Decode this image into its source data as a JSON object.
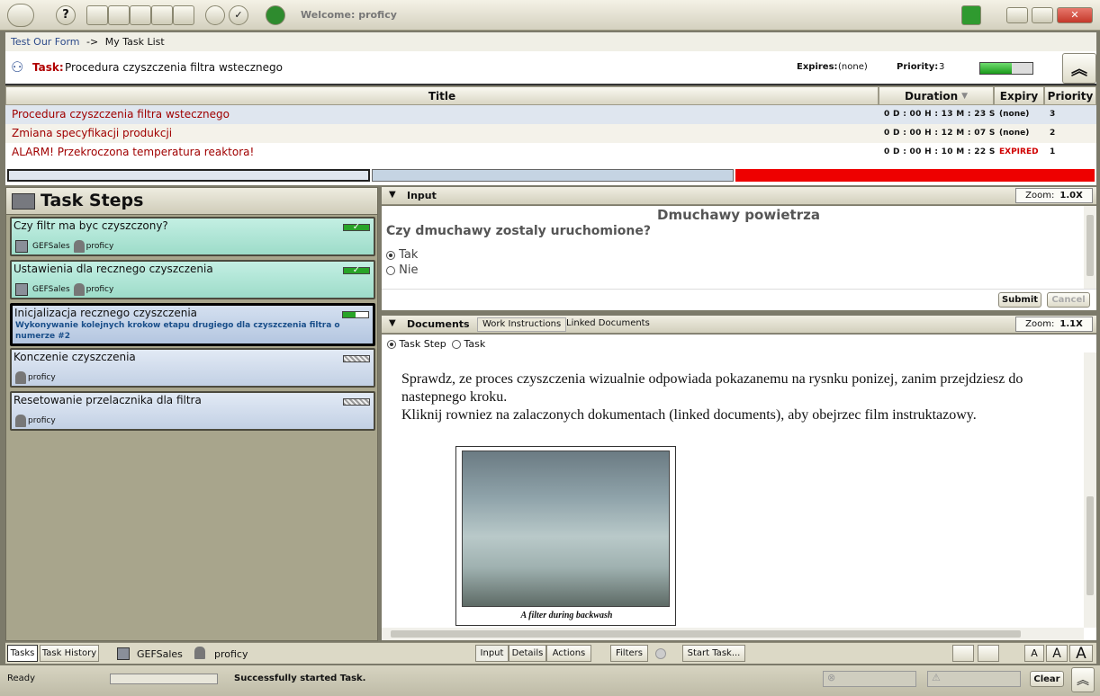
{
  "app": {
    "welcome": "Welcome: proficy"
  },
  "breadcrumb": {
    "form": "Test Our Form",
    "separator": "->",
    "current": "My Task List"
  },
  "task_header": {
    "label": "Task:",
    "name": "Procedura czyszczenia filtra wstecznego",
    "expires_label": "Expires:",
    "expires_value": "(none)",
    "priority_label": "Priority:",
    "priority_value": "3",
    "progress": 0.6
  },
  "task_table": {
    "columns": [
      "Title",
      "Duration",
      "Expiry",
      "Priority"
    ],
    "rows": [
      {
        "title": "Procedura czyszczenia filtra wstecznego",
        "duration": "0 D : 00 H : 13 M : 23 S",
        "expiry": "(none)",
        "priority": "3"
      },
      {
        "title": "Zmiana specyfikacji produkcji",
        "duration": "0 D : 00 H : 12 M : 07 S",
        "expiry": "(none)",
        "priority": "2"
      },
      {
        "title": "ALARM! Przekroczona temperatura reaktora!",
        "duration": "0 D : 00 H : 10 M : 22 S",
        "expiry": "EXPIRED",
        "priority": "1"
      }
    ]
  },
  "steps_panel": {
    "title": "Task Steps",
    "steps": [
      {
        "name": "Czy filtr ma byc czyszczony?",
        "group": "GEFSales",
        "user": "proficy",
        "status": "complete"
      },
      {
        "name": "Ustawienia dla recznego czyszczenia",
        "group": "GEFSales",
        "user": "proficy",
        "status": "complete"
      },
      {
        "name": "Inicjalizacja recznego czyszczenia",
        "description": "Wykonywanie kolejnych krokow etapu drugiego dla czyszczenia filtra o numerze #2",
        "status": "active"
      },
      {
        "name": "Konczenie czyszczenia",
        "user": "proficy",
        "status": "pending"
      },
      {
        "name": "Resetowanie przelacznika dla filtra",
        "user": "proficy",
        "status": "pending"
      }
    ]
  },
  "input_panel": {
    "title": "Input",
    "zoom_label": "Zoom:",
    "zoom_value": "1.0X",
    "heading": "Dmuchawy powietrza",
    "question": "Czy dmuchawy zostaly uruchomione?",
    "options": [
      "Tak",
      "Nie"
    ],
    "selected": "Tak",
    "submit": "Submit",
    "cancel": "Cancel"
  },
  "documents_panel": {
    "title": "Documents",
    "tabs": [
      "Work Instructions",
      "Linked Documents"
    ],
    "zoom_label": "Zoom:",
    "zoom_value": "1.1X",
    "scope_options": [
      "Task Step",
      "Task"
    ],
    "text": "Sprawdz, ze proces czyszczenia wizualnie odpowiada pokazanemu na rysnku ponizej, zanim przejdziesz do nastepnego kroku.",
    "text2": "Kliknij rowniez na zalaczonych dokumentach (linked documents), aby obejrzec film instruktazowy.",
    "image_caption": "A filter during backwash"
  },
  "bottom_tabs": {
    "tabs": "Tasks",
    "history": "Task History",
    "group": "GEFSales",
    "user": "proficy",
    "input": "Input",
    "details": "Details",
    "actions": "Actions",
    "filters": "Filters",
    "start": "Start Task..."
  },
  "status": {
    "ready": "Ready",
    "message": "Successfully started Task.",
    "clear": "Clear"
  },
  "font_size_buttons": [
    "A",
    "A",
    "A"
  ]
}
